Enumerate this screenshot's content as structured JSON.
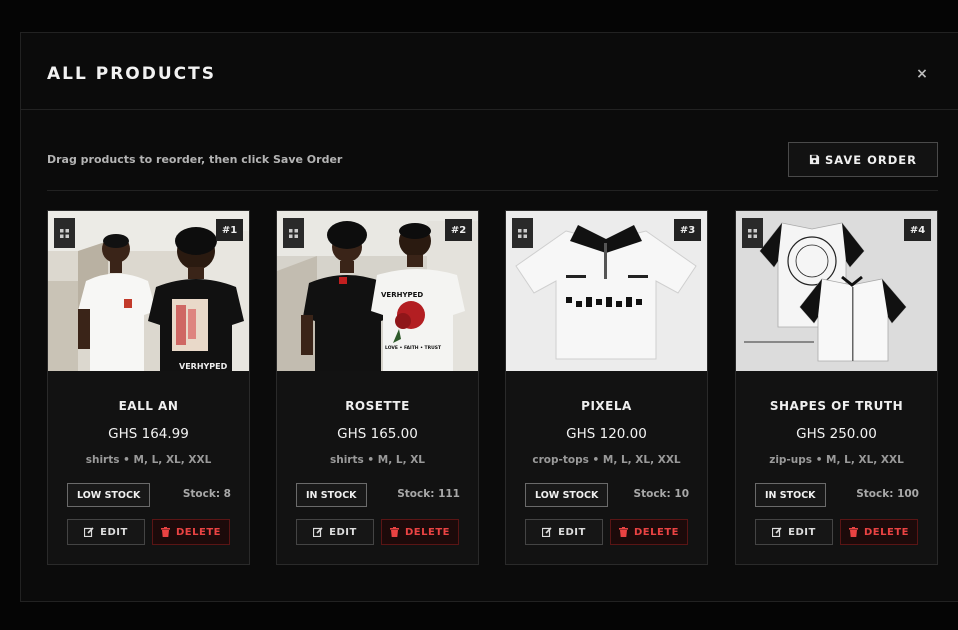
{
  "modal": {
    "title": "ALL PRODUCTS",
    "close_symbol": "×"
  },
  "toolbar": {
    "hint": "Drag products to reorder, then click Save Order",
    "save_label": "SAVE ORDER"
  },
  "products": [
    {
      "position": "#1",
      "name": "EALL AN",
      "price": "GHS 164.99",
      "category": "shirts",
      "sizes": "• M, L, XL, XXL",
      "stock_status": "LOW STOCK",
      "stock_count": "Stock: 8",
      "edit_label": "EDIT",
      "delete_label": "DELETE"
    },
    {
      "position": "#2",
      "name": "ROSETTE",
      "price": "GHS 165.00",
      "category": "shirts",
      "sizes": "• M, L, XL",
      "stock_status": "IN STOCK",
      "stock_count": "Stock: 111",
      "edit_label": "EDIT",
      "delete_label": "DELETE"
    },
    {
      "position": "#3",
      "name": "PIXELA",
      "price": "GHS 120.00",
      "category": "crop-tops",
      "sizes": "• M, L, XL, XXL",
      "stock_status": "LOW STOCK",
      "stock_count": "Stock: 10",
      "edit_label": "EDIT",
      "delete_label": "DELETE"
    },
    {
      "position": "#4",
      "name": "SHAPES OF TRUTH",
      "price": "GHS 250.00",
      "category": "zip-ups",
      "sizes": "• M, L, XL, XXL",
      "stock_status": "IN STOCK",
      "stock_count": "Stock: 100",
      "edit_label": "EDIT",
      "delete_label": "DELETE"
    }
  ],
  "photo_text": {
    "p1_back": "VERHYPED",
    "p2_back": "VERHYPED",
    "p2_back2": "LOVE • FAITH • TRUST"
  },
  "colors": {
    "background": "#050505",
    "card": "#121212",
    "delete_red": "#ea4343"
  },
  "icons": {
    "close": "close-icon",
    "save": "floppy-disk-icon",
    "drag": "grid-dots-icon",
    "edit": "edit-pencil-icon",
    "delete": "trash-icon"
  }
}
